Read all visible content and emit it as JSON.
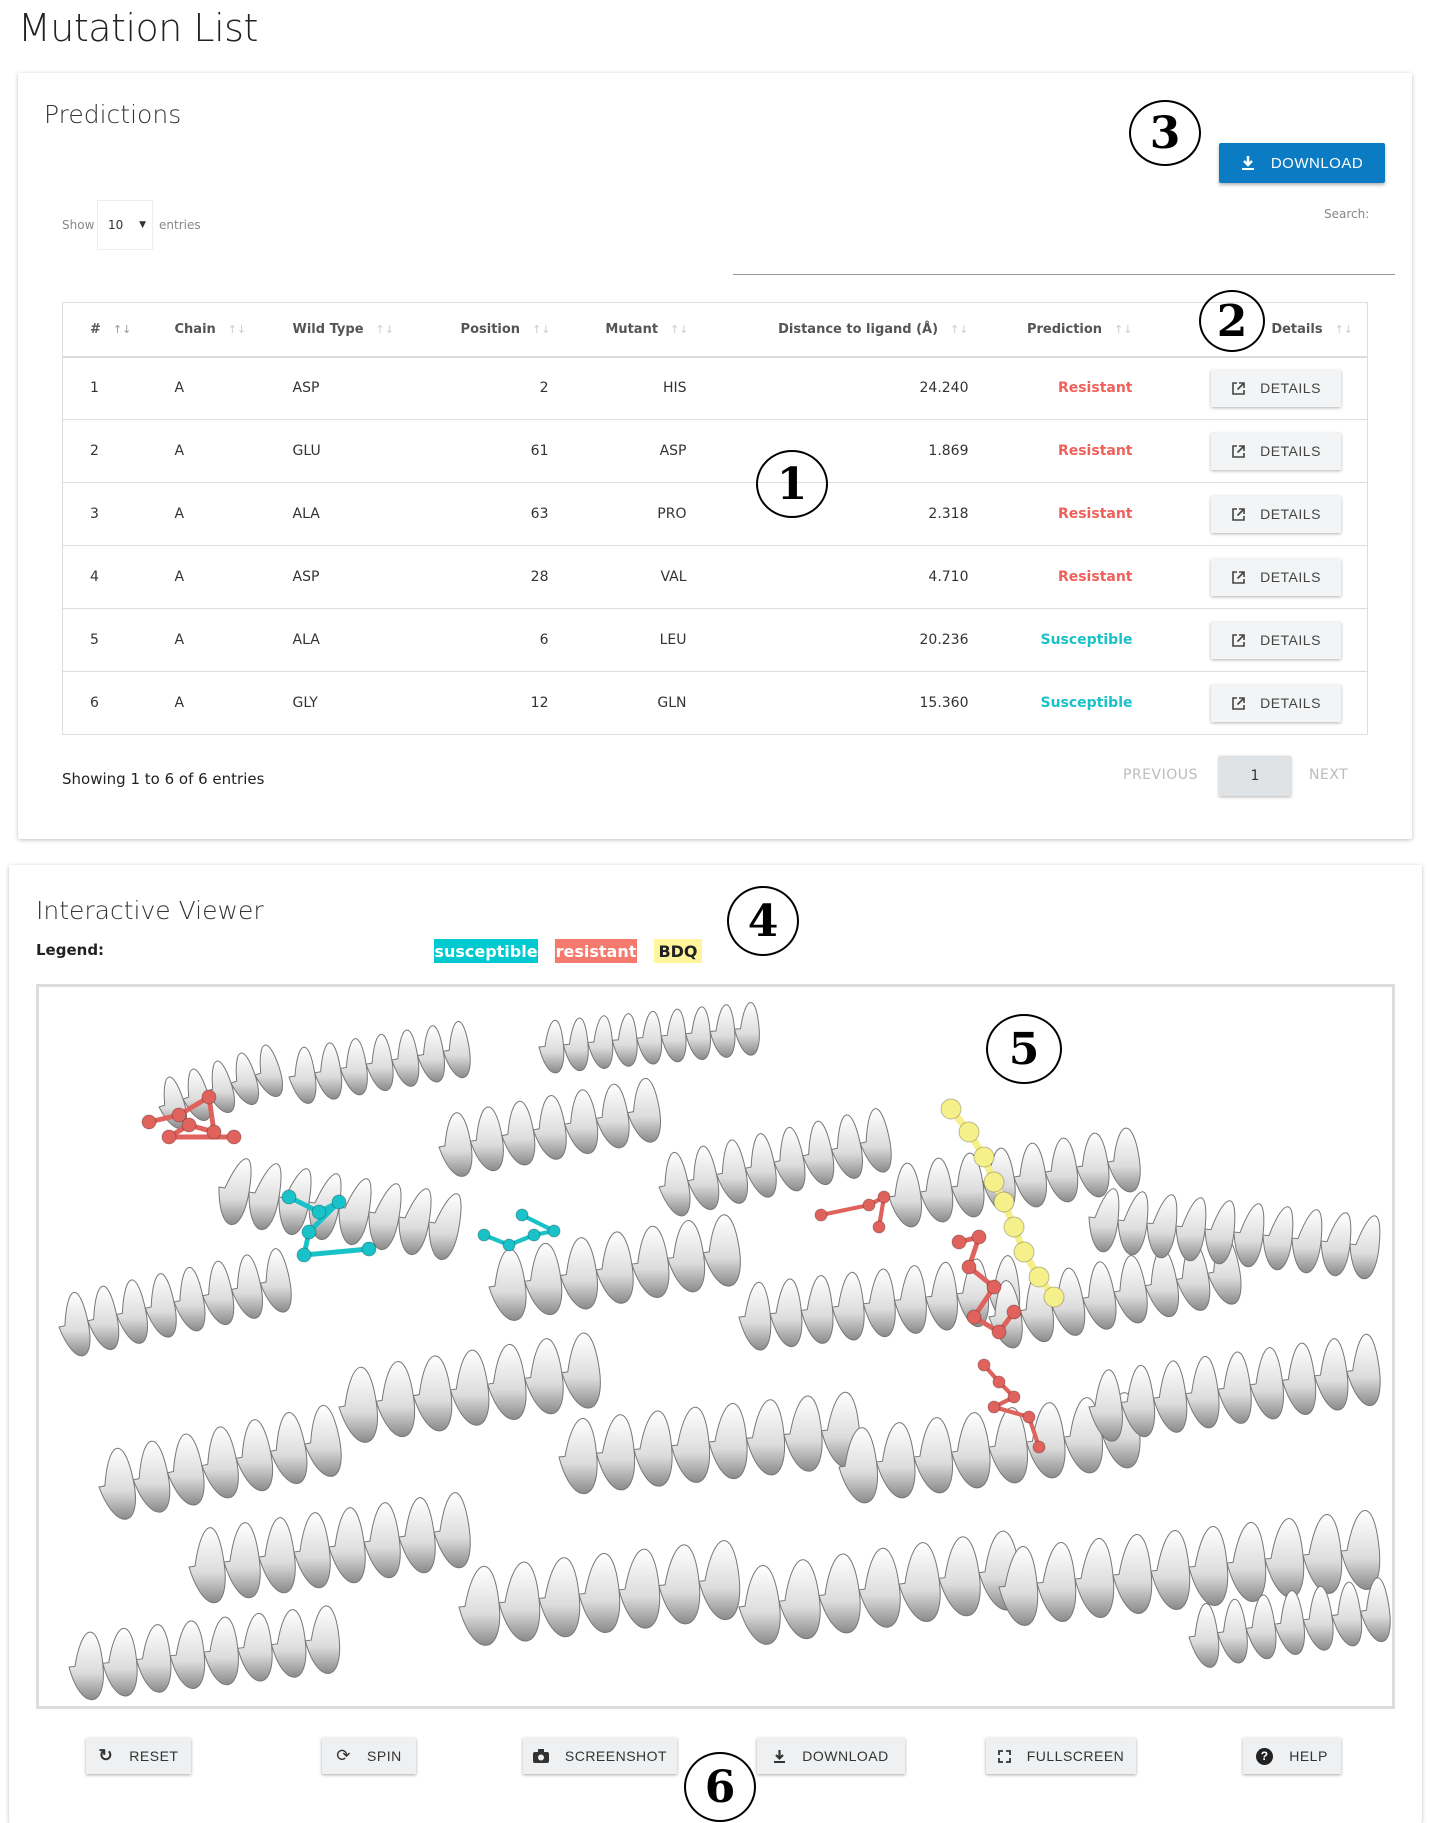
{
  "page_title": "Mutation List",
  "predictions": {
    "title": "Predictions",
    "download_label": "DOWNLOAD",
    "show_label": "Show",
    "entries_label": "entries",
    "page_length": "10",
    "search_label": "Search:",
    "search_value": "",
    "columns": [
      "#",
      "Chain",
      "Wild Type",
      "Position",
      "Mutant",
      "Distance to ligand (Å)",
      "Prediction",
      "Details"
    ],
    "rows": [
      {
        "n": "1",
        "chain": "A",
        "wild": "ASP",
        "pos": "2",
        "mutant": "HIS",
        "dist": "24.240",
        "pred": "Resistant",
        "details": "DETAILS"
      },
      {
        "n": "2",
        "chain": "A",
        "wild": "GLU",
        "pos": "61",
        "mutant": "ASP",
        "dist": "1.869",
        "pred": "Resistant",
        "details": "DETAILS"
      },
      {
        "n": "3",
        "chain": "A",
        "wild": "ALA",
        "pos": "63",
        "mutant": "PRO",
        "dist": "2.318",
        "pred": "Resistant",
        "details": "DETAILS"
      },
      {
        "n": "4",
        "chain": "A",
        "wild": "ASP",
        "pos": "28",
        "mutant": "VAL",
        "dist": "4.710",
        "pred": "Resistant",
        "details": "DETAILS"
      },
      {
        "n": "5",
        "chain": "A",
        "wild": "ALA",
        "pos": "6",
        "mutant": "LEU",
        "dist": "20.236",
        "pred": "Susceptible",
        "details": "DETAILS"
      },
      {
        "n": "6",
        "chain": "A",
        "wild": "GLY",
        "pos": "12",
        "mutant": "GLN",
        "dist": "15.360",
        "pred": "Susceptible",
        "details": "DETAILS"
      }
    ],
    "info": "Showing 1 to 6 of 6 entries",
    "previous": "PREVIOUS",
    "current_page": "1",
    "next": "NEXT"
  },
  "viewer": {
    "title": "Interactive Viewer",
    "legend_label": "Legend:",
    "legend": [
      {
        "label": "susceptible",
        "color": "#00c9d0",
        "text_color": "#ffffff"
      },
      {
        "label": "resistant",
        "color": "#f47a6e",
        "text_color": "#ffffff"
      },
      {
        "label": "BDQ",
        "color": "#fff59d",
        "text_color": "#222222"
      }
    ],
    "buttons": [
      {
        "label": "RESET",
        "icon": "reset-icon"
      },
      {
        "label": "SPIN",
        "icon": "spin-icon"
      },
      {
        "label": "SCREENSHOT",
        "icon": "camera-icon"
      },
      {
        "label": "DOWNLOAD",
        "icon": "download-icon"
      },
      {
        "label": "FULLSCREEN",
        "icon": "fullscreen-icon"
      },
      {
        "label": "HELP",
        "icon": "help-icon"
      }
    ]
  },
  "annotations": [
    "1",
    "2",
    "3",
    "4",
    "5",
    "6"
  ],
  "colors": {
    "primary": "#0b7cc4",
    "resistant": "#f0605a",
    "susceptible": "#19c2c8",
    "ligand": "#f5f08a"
  }
}
